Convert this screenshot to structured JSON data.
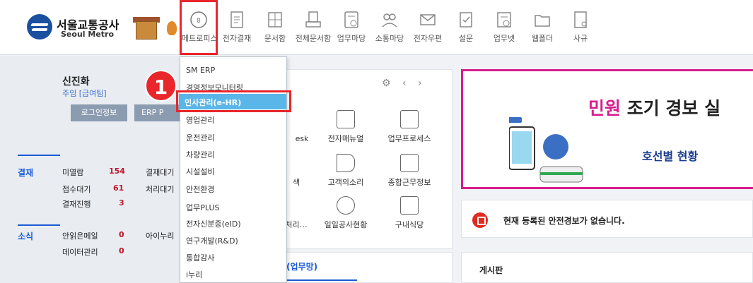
{
  "logo": {
    "korean": "서울교통공사",
    "english": "Seoul Metro"
  },
  "nav": [
    {
      "label": "메트로피스",
      "icon": "metrofis-icon",
      "active": true
    },
    {
      "label": "전자결재",
      "icon": "approval-icon"
    },
    {
      "label": "문서함",
      "icon": "document-box-icon"
    },
    {
      "label": "전체문서함",
      "icon": "all-documents-icon"
    },
    {
      "label": "업무마당",
      "icon": "work-field-icon"
    },
    {
      "label": "소통마당",
      "icon": "community-icon"
    },
    {
      "label": "전자우편",
      "icon": "mail-icon"
    },
    {
      "label": "설문",
      "icon": "survey-icon"
    },
    {
      "label": "업무넷",
      "icon": "worknet-icon"
    },
    {
      "label": "웹폴더",
      "icon": "web-folder-icon"
    },
    {
      "label": "사규",
      "icon": "regulations-icon"
    }
  ],
  "user": {
    "name": "신진화",
    "role": "주임 [급여팀]"
  },
  "buttons": {
    "login_info": "로그인정보",
    "erp": "ERP P"
  },
  "stats": {
    "approval_label": "결재",
    "approval_rows": [
      {
        "label": "미열람",
        "value": "154",
        "extra": "결재대기"
      },
      {
        "label": "접수대기",
        "value": "61",
        "extra": "처리대기"
      },
      {
        "label": "결재진행",
        "value": "3"
      }
    ],
    "news_label": "소식",
    "news_rows": [
      {
        "label": "안읽은메일",
        "value": "0",
        "extra": "아이누리"
      },
      {
        "label": "데이터관리",
        "value": "0"
      }
    ]
  },
  "dropdown": {
    "items": [
      "SM ERP",
      "경영정보모니터링",
      "인사관리(e-HR)",
      "영업관리",
      "운전관리",
      "차량관리",
      "시설설비",
      "안전환경",
      "업무PLUS",
      "전자신분증(eID)",
      "연구개발(R&D)",
      "통합감사",
      "i누리"
    ],
    "highlighted": "인사관리(e-HR)"
  },
  "badge": "1",
  "mid": {
    "controls": "⚙ ‹ ›",
    "row1": [
      "esk",
      "전자매뉴얼",
      "업무프로세스"
    ],
    "row2": [
      "색",
      "고객의소리",
      "종합근무정보"
    ],
    "row3": [
      "처리…",
      "일일공사현황",
      "구내식당"
    ],
    "tab": "(업무망)"
  },
  "banner": {
    "title_pink": "민원",
    "title_rest": " 조기 경보 실",
    "subtitle": "호선별 현황"
  },
  "alert": {
    "text": "현재 등록된 안전경보가 없습니다."
  },
  "board": {
    "title": "게시판"
  }
}
